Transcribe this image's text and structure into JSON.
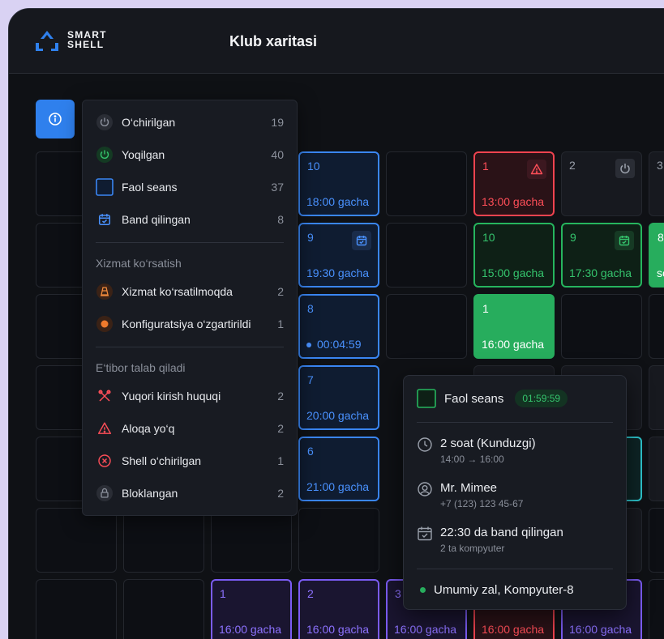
{
  "header": {
    "logo_line1": "SMART",
    "logo_line2": "SHELL",
    "title": "Klub xaritasi"
  },
  "legend": {
    "items": [
      {
        "label": "O‘chirilgan",
        "count": "19"
      },
      {
        "label": "Yoqilgan",
        "count": "40"
      },
      {
        "label": "Faol seans",
        "count": "37"
      },
      {
        "label": "Band qilingan",
        "count": "8"
      }
    ],
    "service_title": "Xizmat ko‘rsatish",
    "service": [
      {
        "label": "Xizmat ko‘rsatilmoqda",
        "count": "2"
      },
      {
        "label": "Konfiguratsiya o‘zgartirildi",
        "count": "1"
      }
    ],
    "attention_title": "E‘tibor talab qiladi",
    "attention": [
      {
        "label": "Yuqori kirish huquqi",
        "count": "2"
      },
      {
        "label": "Aloqa yo‘q",
        "count": "2"
      },
      {
        "label": "Shell o‘chirilgan",
        "count": "1"
      },
      {
        "label": "Bloklangan",
        "count": "2"
      }
    ]
  },
  "cells": {
    "c1": {
      "num": "10",
      "time": "18:00 gacha"
    },
    "c2": {
      "num": "1",
      "time": "13:00 gacha"
    },
    "c3": {
      "num": "2"
    },
    "c4": {
      "num": "3"
    },
    "c5": {
      "num": "9",
      "time": "19:30 gacha"
    },
    "c6": {
      "num": "10",
      "time": "15:00 gacha"
    },
    "c7": {
      "num": "9",
      "time": "17:30 gacha"
    },
    "c8": {
      "num": "8",
      "time": "so"
    },
    "c9": {
      "num": "8",
      "time": "00:04:59"
    },
    "c10": {
      "num": "1",
      "time": "16:00 gacha"
    },
    "c11": {
      "num": "7",
      "time": "20:00 gacha"
    },
    "c12": {
      "num": "6",
      "time": "21:00 gacha"
    },
    "c13": {
      "time": "ha"
    },
    "c14": {
      "num": "1",
      "time": "16:00 gacha"
    },
    "c15": {
      "num": "2",
      "time": "16:00 gacha"
    },
    "c16": {
      "num": "3",
      "time": "16:00 gacha"
    },
    "c17": {
      "time": "16:00 gacha"
    },
    "c18": {
      "time": "16:00 gacha"
    }
  },
  "popup": {
    "status": "Faol seans",
    "timer": "01:59:59",
    "tariff": "2 soat (Kunduzgi)",
    "tariff_range": "14:00 → 16:00",
    "user": "Mr. Mimee",
    "phone": "+7 (123) 123 45-67",
    "booking": "22:30 da band qilingan",
    "booking_sub": "2 ta kompyuter",
    "location": "Umumiy zal, Kompyuter-8"
  },
  "colors": {
    "accent": "#2f80ed",
    "active": "#3a86f3",
    "on": "#27ad5d",
    "error": "#f0434f",
    "booked": "#7b5cf3"
  }
}
